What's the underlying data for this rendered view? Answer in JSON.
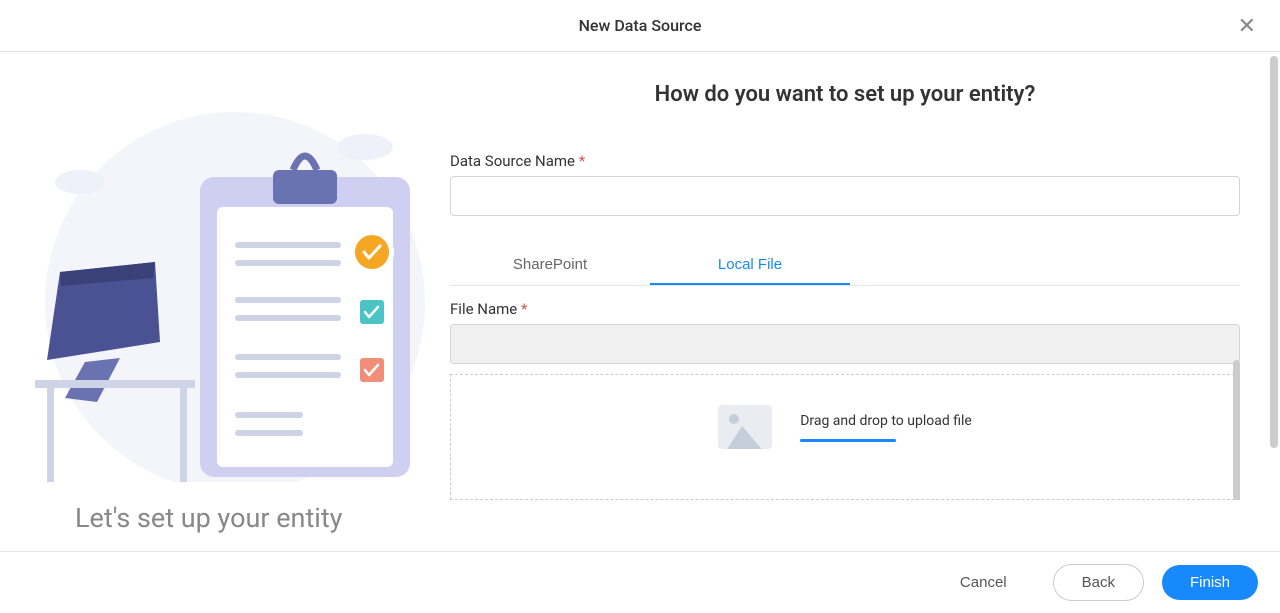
{
  "header": {
    "title": "New Data Source"
  },
  "left": {
    "caption": "Let's set up your entity"
  },
  "right": {
    "heading": "How do you want to set up your entity?",
    "data_source_label": "Data Source Name",
    "data_source_value": "",
    "tabs": {
      "sharepoint": "SharePoint",
      "local_file": "Local File"
    },
    "file_name_label": "File Name",
    "file_name_value": "",
    "dropzone_text": "Drag and drop to upload file"
  },
  "footer": {
    "cancel": "Cancel",
    "back": "Back",
    "finish": "Finish"
  }
}
